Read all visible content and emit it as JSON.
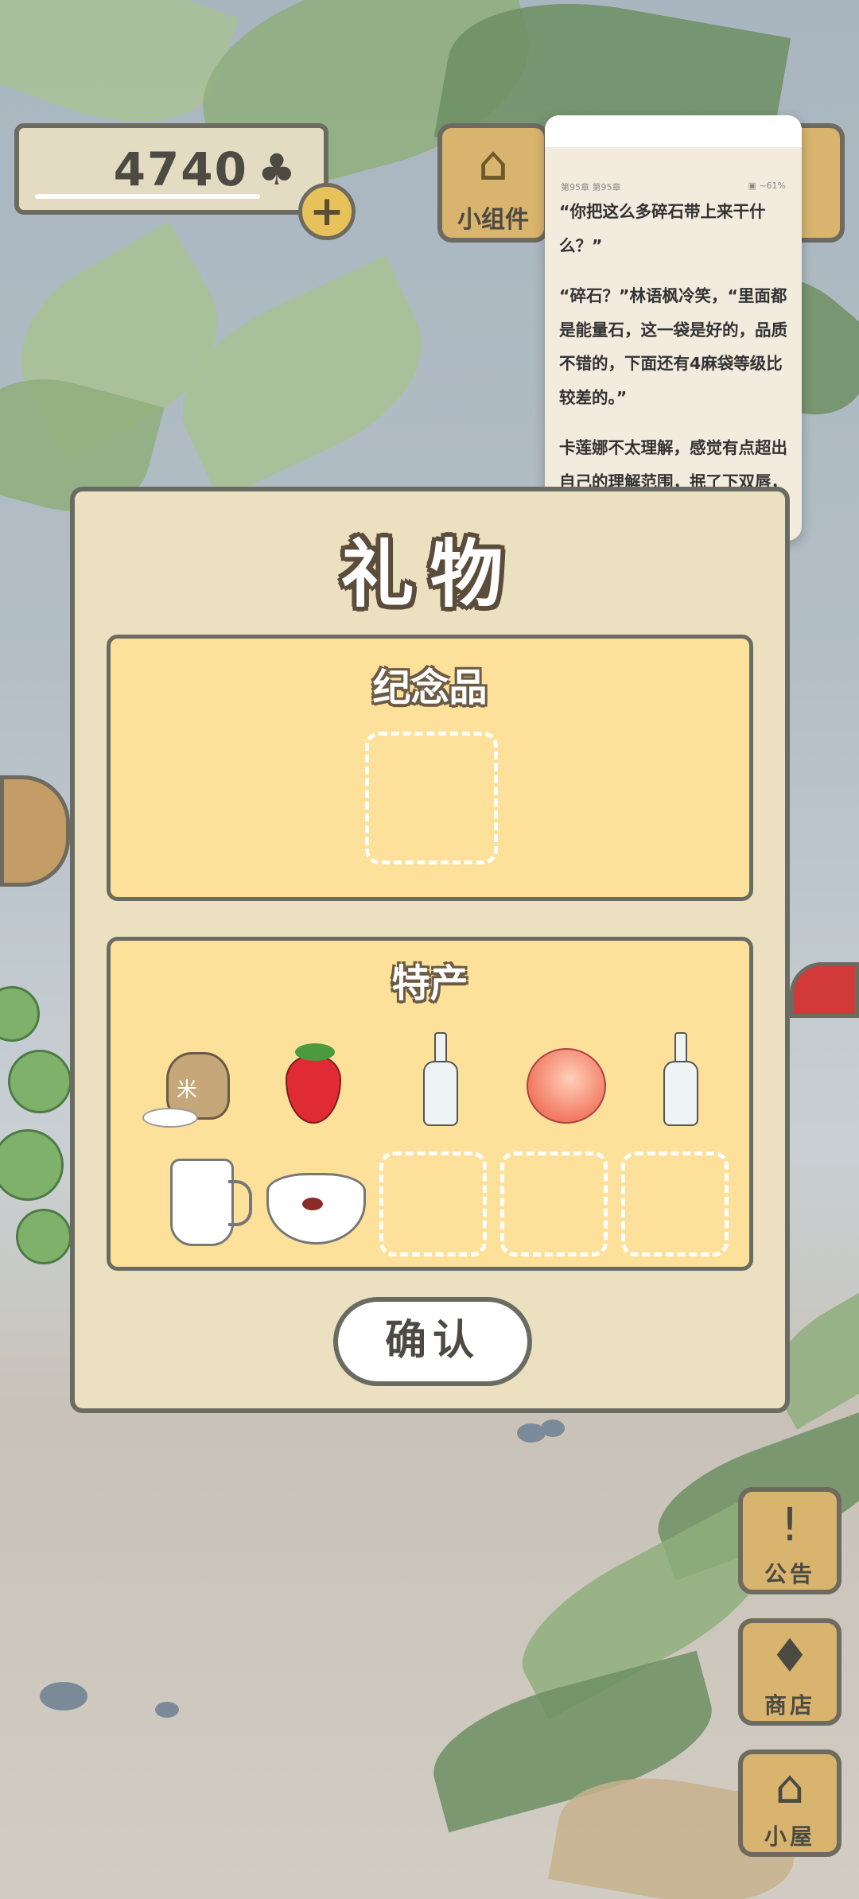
{
  "hud": {
    "clover_count": "4740",
    "clover_icon": "♣",
    "plus_label": "+",
    "widget_label": "小组件"
  },
  "reader": {
    "meta_left": "第95章 第95章",
    "meta_right": "▣ ~61%",
    "paragraphs": [
      "“你把这么多碎石带上来干什么？”",
      "“碎石？”林语枫冷笑，“里面都是能量石，这一袋是好的，品质不错的，下面还有4麻袋等级比较差的。”",
      "卡莲娜不太理解，感觉有点超出自己的理解范围，抿了下双唇，打开袋子看了眼，又皱"
    ]
  },
  "dialog": {
    "title": "礼物",
    "souvenir_title": "纪念品",
    "specialty_title": "特产",
    "specialty_items": [
      "rice-sack-icon",
      "strawberry-icon",
      "glass-bottle-icon",
      "peach-icon",
      "glass-bottle-icon",
      "milk-jug-icon",
      "rice-bowl-icon"
    ],
    "confirm_label": "确认"
  },
  "side_buttons": {
    "notice_label": "公告",
    "shop_label": "商店",
    "house_label": "小屋"
  },
  "colors": {
    "dialog_bg": "#ebe0bf",
    "panel_bg": "#fde09a",
    "button_wood": "#d8b46e",
    "outline": "#6a6c63"
  }
}
